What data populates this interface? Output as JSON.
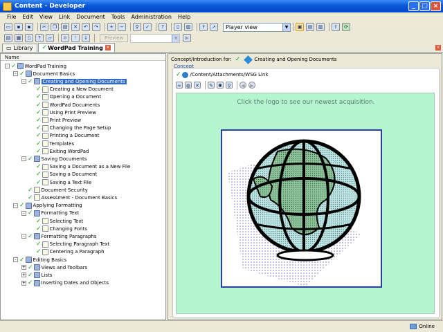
{
  "window": {
    "title": "Content - Developer"
  },
  "menu": [
    "File",
    "Edit",
    "View",
    "Link",
    "Document",
    "Tools",
    "Administration",
    "Help"
  ],
  "toolbar": {
    "view_select": "Player view",
    "preview_label": "Preview"
  },
  "tabs": [
    {
      "label": "Library"
    },
    {
      "label": "WordPad Training"
    }
  ],
  "tree": {
    "header": "Name",
    "rows": [
      {
        "label": "WordPad Training",
        "level": 0,
        "expander": "-",
        "icon": "book"
      },
      {
        "label": "Document Basics",
        "level": 1,
        "expander": "-",
        "icon": "book"
      },
      {
        "label": "Creating and Opening Documents",
        "level": 2,
        "expander": "-",
        "icon": "book",
        "selected": true
      },
      {
        "label": "Creating a New Document",
        "level": 3,
        "icon": "page"
      },
      {
        "label": "Opening a Document",
        "level": 3,
        "icon": "page"
      },
      {
        "label": "WordPad Documents",
        "level": 3,
        "icon": "page"
      },
      {
        "label": "Using Print Preview",
        "level": 3,
        "icon": "page"
      },
      {
        "label": "Print Preview",
        "level": 3,
        "icon": "page"
      },
      {
        "label": "Changing the Page Setup",
        "level": 3,
        "icon": "page"
      },
      {
        "label": "Printing a Document",
        "level": 3,
        "icon": "page"
      },
      {
        "label": "Templates",
        "level": 3,
        "icon": "page"
      },
      {
        "label": "Exiting WordPad",
        "level": 3,
        "icon": "page"
      },
      {
        "label": "Saving Documents",
        "level": 2,
        "expander": "-",
        "icon": "book"
      },
      {
        "label": "Saving a Document as a New File",
        "level": 3,
        "icon": "page"
      },
      {
        "label": "Saving a Document",
        "level": 3,
        "icon": "page"
      },
      {
        "label": "Saving a Text File",
        "level": 3,
        "icon": "page"
      },
      {
        "label": "Document Security",
        "level": 2,
        "icon": "page"
      },
      {
        "label": "Assessment - Document Basics",
        "level": 2,
        "icon": "page"
      },
      {
        "label": "Applying Formatting",
        "level": 1,
        "expander": "-",
        "icon": "book"
      },
      {
        "label": "Formatting Text",
        "level": 2,
        "expander": "-",
        "icon": "book"
      },
      {
        "label": "Selecting Text",
        "level": 3,
        "icon": "page"
      },
      {
        "label": "Changing Fonts",
        "level": 3,
        "icon": "page"
      },
      {
        "label": "Formatting Paragraphs",
        "level": 2,
        "expander": "-",
        "icon": "book"
      },
      {
        "label": "Selecting Paragraph Text",
        "level": 3,
        "icon": "page"
      },
      {
        "label": "Centering a Paragraph",
        "level": 3,
        "icon": "page"
      },
      {
        "label": "Editing Basics",
        "level": 1,
        "expander": "-",
        "icon": "book"
      },
      {
        "label": "Views and Toolbars",
        "level": 2,
        "expander": "+",
        "icon": "book"
      },
      {
        "label": "Lists",
        "level": 2,
        "expander": "+",
        "icon": "book"
      },
      {
        "label": "Inserting Dates and Objects",
        "level": 2,
        "expander": "+",
        "icon": "book"
      }
    ]
  },
  "concept": {
    "header_label": "Concept/Introduction for:",
    "header_doc": "Creating and Opening Documents",
    "tab_label": "Concept",
    "link_path": "/Content/Attachments/WSG Link",
    "message": "Click the logo to see our newest acquisition."
  },
  "status": {
    "online": "Online"
  },
  "colors": {
    "content_bg": "#b4f5cf",
    "selection": "#316ac5",
    "title_blue": "#0a58d8",
    "logo_border": "#2a3ea8"
  }
}
